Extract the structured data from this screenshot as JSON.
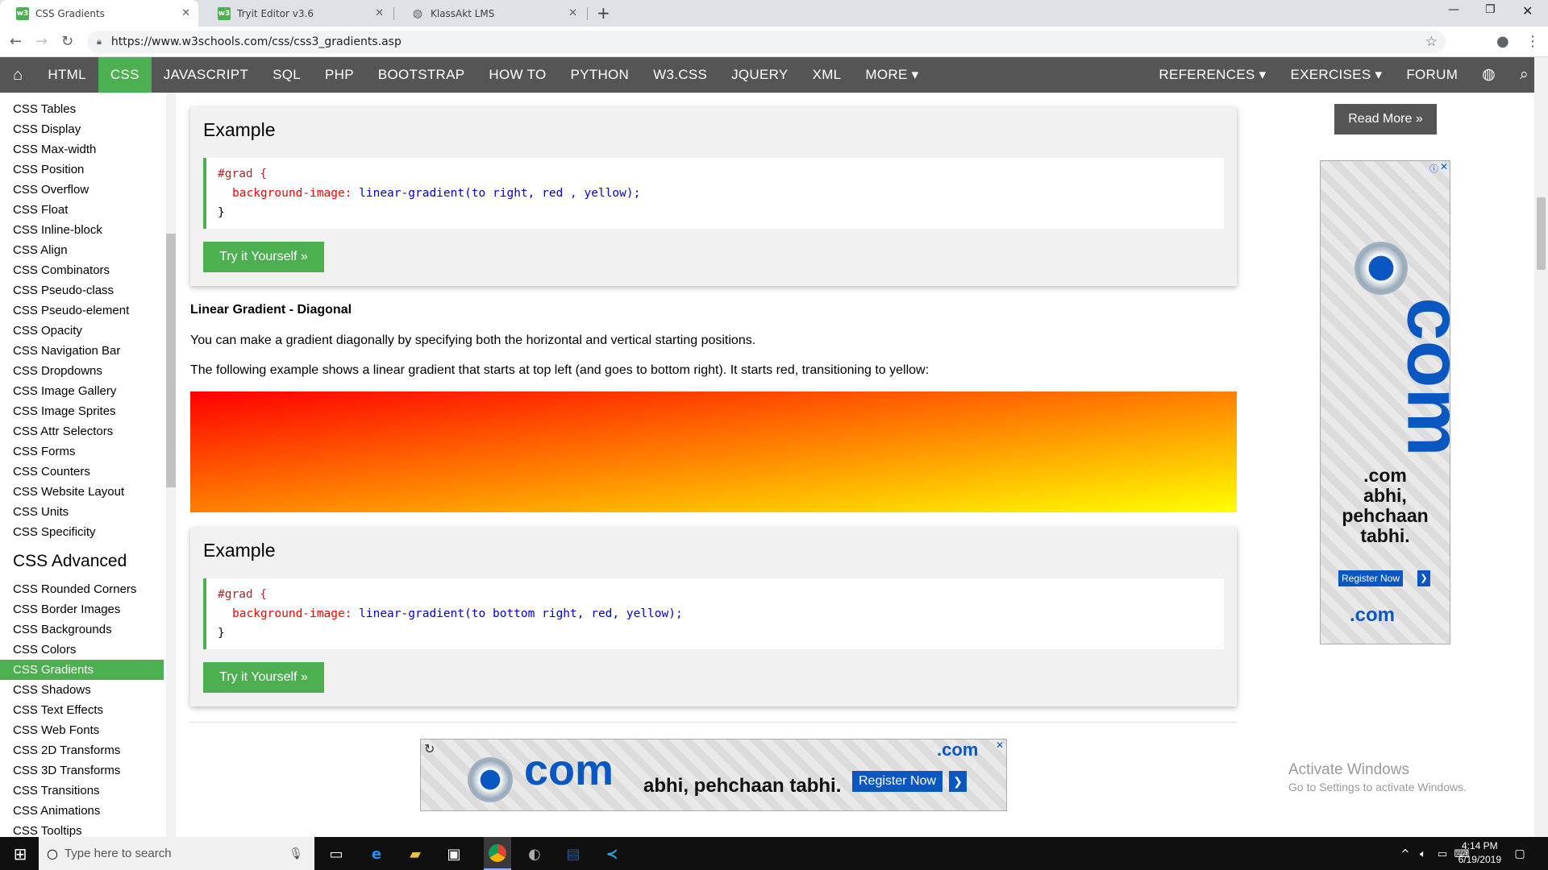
{
  "browser": {
    "tabs": [
      {
        "label": "CSS Gradients",
        "favicon": "w3"
      },
      {
        "label": "Tryit Editor v3.6",
        "favicon": "w3"
      },
      {
        "label": "KlassAkt LMS",
        "favicon": "globe"
      }
    ],
    "url": "https://www.w3schools.com/css/css3_gradients.asp"
  },
  "topnav": {
    "items": [
      "HTML",
      "CSS",
      "JAVASCRIPT",
      "SQL",
      "PHP",
      "BOOTSTRAP",
      "HOW TO",
      "PYTHON",
      "W3.CSS",
      "JQUERY",
      "XML",
      "MORE ▾"
    ],
    "active": "CSS",
    "right": [
      "REFERENCES ▾",
      "EXERCISES ▾",
      "FORUM"
    ]
  },
  "sidebar": {
    "items_top": [
      "CSS Tables",
      "CSS Display",
      "CSS Max-width",
      "CSS Position",
      "CSS Overflow",
      "CSS Float",
      "CSS Inline-block",
      "CSS Align",
      "CSS Combinators",
      "CSS Pseudo-class",
      "CSS Pseudo-element",
      "CSS Opacity",
      "CSS Navigation Bar",
      "CSS Dropdowns",
      "CSS Image Gallery",
      "CSS Image Sprites",
      "CSS Attr Selectors",
      "CSS Forms",
      "CSS Counters",
      "CSS Website Layout",
      "CSS Units",
      "CSS Specificity"
    ],
    "advanced_heading": "CSS Advanced",
    "items_advanced": [
      "CSS Rounded Corners",
      "CSS Border Images",
      "CSS Backgrounds",
      "CSS Colors",
      "CSS Gradients",
      "CSS Shadows",
      "CSS Text Effects",
      "CSS Web Fonts",
      "CSS 2D Transforms",
      "CSS 3D Transforms",
      "CSS Transitions",
      "CSS Animations",
      "CSS Tooltips"
    ],
    "active": "CSS Gradients"
  },
  "example1": {
    "heading": "Example",
    "selector": "#grad {",
    "property": "background-image:",
    "value": "linear-gradient(to right, red , yellow);",
    "close": "}",
    "button": "Try it Yourself »"
  },
  "section": {
    "title": "Linear Gradient - Diagonal",
    "p1": "You can make a gradient diagonally by specifying both the horizontal and vertical starting positions.",
    "p2": "The following example shows a linear gradient that starts at top left (and goes to bottom right). It starts red, transitioning to yellow:"
  },
  "example2": {
    "heading": "Example",
    "selector": "#grad {",
    "property": "background-image:",
    "value": "linear-gradient(to bottom right, red, yellow);",
    "close": "}",
    "button": "Try it Yourself »"
  },
  "right": {
    "read_more": "Read More »",
    "ad": {
      "big": "com",
      "tagline1": ".com",
      "tagline2": "abhi,",
      "tagline3": "pehchaan",
      "tagline4": "tabhi.",
      "register": "Register Now",
      "logo": ".com"
    }
  },
  "banner_ad": {
    "big": "com",
    "tagline": "abhi, pehchaan tabhi.",
    "register": "Register Now",
    "logo": ".com"
  },
  "watermark": {
    "line1": "Activate Windows",
    "line2": "Go to Settings to activate Windows."
  },
  "taskbar": {
    "search_placeholder": "Type here to search",
    "time": "4:14 PM",
    "date": "6/19/2019"
  },
  "colors": {
    "accent": "#4CAF50",
    "nav": "#555555",
    "ad_blue": "#0a57c2"
  }
}
